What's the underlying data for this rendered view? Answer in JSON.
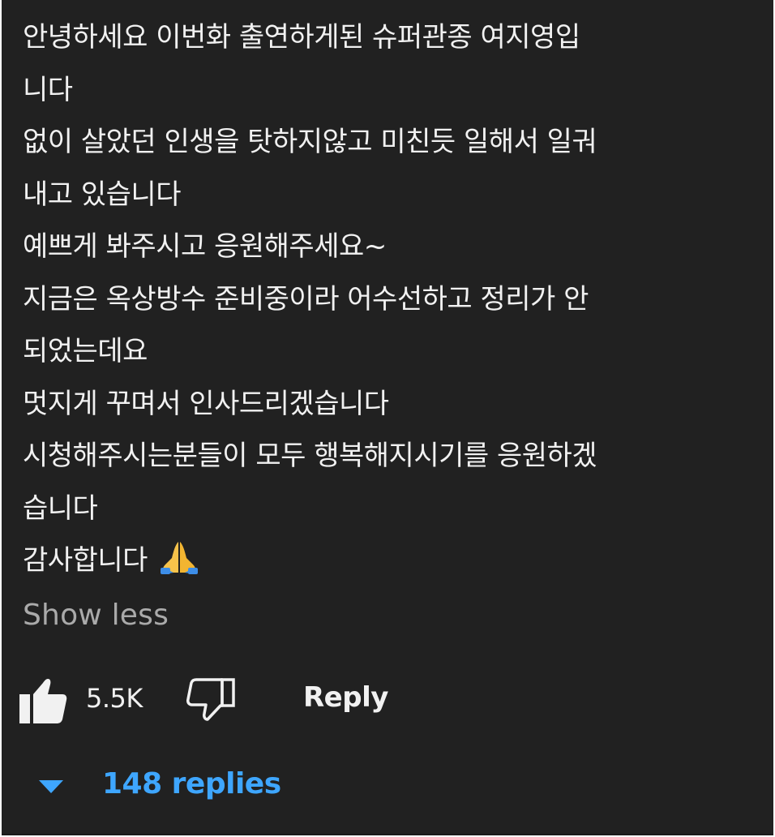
{
  "comment": {
    "lines": [
      "안녕하세요 이번화 출연하게된 슈퍼관종 여지영입",
      "니다",
      "없이 살았던 인생을 탓하지않고 미친듯 일해서 일궈",
      "내고 있습니다",
      "예쁘게 봐주시고 응원해주세요~",
      "지금은 옥상방수 준비중이라 어수선하고 정리가 안",
      "되었는데요",
      "멋지게 꾸며서 인사드리겠습니다",
      "시청해주시는분들이 모두 행복해지시기를 응원하겠",
      "습니다",
      "감사합니다"
    ],
    "emoji": "folded-hands-emoji",
    "show_less": "Show less"
  },
  "actions": {
    "like_icon": "thumbs-up-icon",
    "like_count": "5.5K",
    "dislike_icon": "thumbs-down-icon",
    "reply_label": "Reply"
  },
  "replies": {
    "caret_icon": "caret-down-icon",
    "label": "148 replies"
  },
  "colors": {
    "background": "#212121",
    "text": "#f1f1f1",
    "muted": "#aaaaaa",
    "link": "#3ea6ff"
  }
}
